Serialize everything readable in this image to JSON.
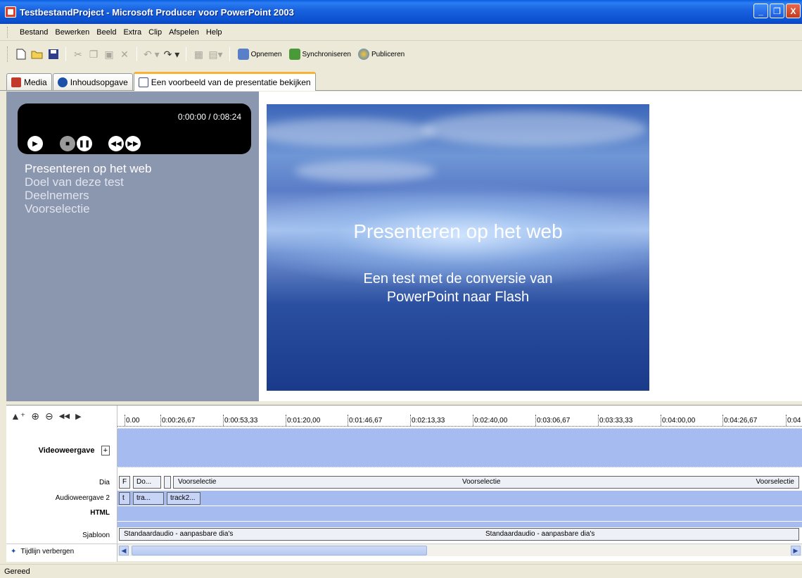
{
  "window": {
    "title": "TestbestandProject - Microsoft Producer voor PowerPoint 2003",
    "min": "_",
    "restore": "❐",
    "close": "X"
  },
  "menu": [
    "Bestand",
    "Bewerken",
    "Beeld",
    "Extra",
    "Clip",
    "Afspelen",
    "Help"
  ],
  "toolbar": {
    "record": "Opnemen",
    "sync": "Synchroniseren",
    "publish": "Publiceren"
  },
  "tabs": {
    "media": "Media",
    "toc": "Inhoudsopgave",
    "preview": "Een voorbeeld van de presentatie bekijken"
  },
  "player": {
    "time": "0:00:00 / 0:08:24"
  },
  "toc_items": [
    "Presenteren op het web",
    "Doel van deze test",
    "Deelnemers",
    "Voorselectie"
  ],
  "slide": {
    "title": "Presenteren op het web",
    "subtitle_line1": "Een test met de conversie van",
    "subtitle_line2": "PowerPoint naar Flash"
  },
  "timeline": {
    "ticks": [
      "0.00",
      "0:00:26,67",
      "0:00:53,33",
      "0:01:20,00",
      "0:01:46,67",
      "0:02:13,33",
      "0:02:40,00",
      "0:03:06,67",
      "0:03:33,33",
      "0:04:00,00",
      "0:04:26,67",
      "0:04"
    ],
    "labels": {
      "video": "Videoweergave",
      "dia": "Dia",
      "audio": "Audioweergave 2",
      "html": "HTML",
      "template": "Sjabloon"
    },
    "dia_clips": {
      "f": "F",
      "do": "Do...",
      "voor1": "Voorselectie",
      "voor2": "Voorselectie",
      "voor3": "Voorselectie"
    },
    "audio_clips": {
      "t": "t",
      "tra": "tra...",
      "track2": "track2..."
    },
    "template_clips": {
      "a": "Standaardaudio - aanpasbare dia's",
      "b": "Standaardaudio - aanpasbare dia's"
    },
    "hide": "Tijdlijn verbergen"
  },
  "status": "Gereed"
}
